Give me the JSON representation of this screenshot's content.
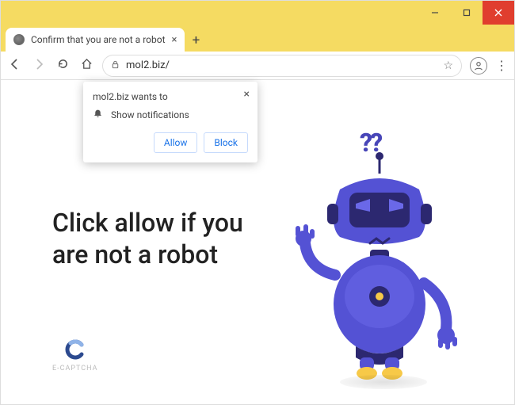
{
  "window": {
    "tab_title": "Confirm that you are not a robot",
    "url_display": "mol2.biz/"
  },
  "permission_prompt": {
    "origin_text": "mol2.biz wants to",
    "permission_label": "Show notifications",
    "allow_label": "Allow",
    "block_label": "Block"
  },
  "page": {
    "hero_text": "Click allow if you are not a robot",
    "captcha_label": "E-CAPTCHA",
    "question_marks": "??"
  },
  "colors": {
    "accent_yellow": "#f5db62",
    "robot_primary": "#4f4fcf",
    "robot_dark": "#2c2870",
    "link_blue": "#1a73e8"
  }
}
